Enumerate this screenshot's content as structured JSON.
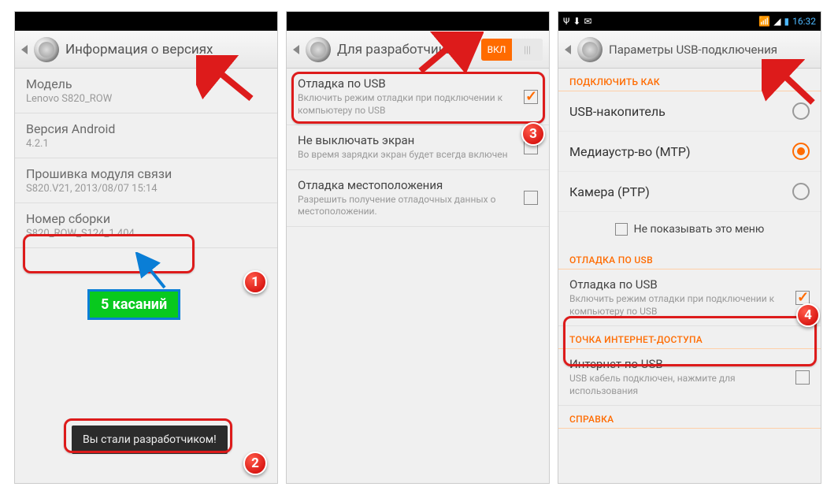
{
  "annotations": {
    "tooltip": "5 касаний",
    "toast": "Вы стали разработчиком!",
    "badges": [
      "1",
      "2",
      "3",
      "4"
    ]
  },
  "panel1": {
    "title": "Информация о версиях",
    "items": [
      {
        "title": "Модель",
        "sub": "Lenovo S820_ROW"
      },
      {
        "title": "Версия Android",
        "sub": "4.2.1"
      },
      {
        "title": "Прошивка модуля связи",
        "sub": "S820.V21, 2013/08/07 15:14"
      },
      {
        "title": "Номер сборки",
        "sub": "S820_ROW_S124_1   404"
      }
    ]
  },
  "panel2": {
    "title": "Для разработчик…",
    "toggle_on": "ВКЛ",
    "toggle_off": "|||",
    "rows": [
      {
        "title": "Отладка по USB",
        "sub": "Включить режим отладки при подключении к компьютеру по USB",
        "checked": true
      },
      {
        "title": "Не выключать экран",
        "sub": "Во время зарядки экран будет всегда включен",
        "checked": false
      },
      {
        "title": "Отладка местоположения",
        "sub": "Разрешить получение отладочных данных о местоположении.",
        "checked": false
      }
    ]
  },
  "panel3": {
    "status_time": "16:32",
    "title": "Параметры USB-подключения",
    "section1": "ПОДКЛЮЧИТЬ КАК",
    "radios": [
      {
        "label": "USB-накопитель",
        "selected": false
      },
      {
        "label": "Медиаустр-во (MTP)",
        "selected": true
      },
      {
        "label": "Камера (PTP)",
        "selected": false
      }
    ],
    "dont_show": "Не показывать это меню",
    "section2": "ОТЛАДКА ПО USB",
    "debug": {
      "title": "Отладка по USB",
      "sub": "Включить режим отладки при подключении к компьютеру по USB",
      "checked": true
    },
    "section3": "ТОЧКА ИНТЕРНЕТ-ДОСТУПА",
    "inet": {
      "title": "Интернет по USB",
      "sub": "USB кабель подключен, нажмите для использования",
      "checked": false
    },
    "section4": "СПРАВКА"
  }
}
